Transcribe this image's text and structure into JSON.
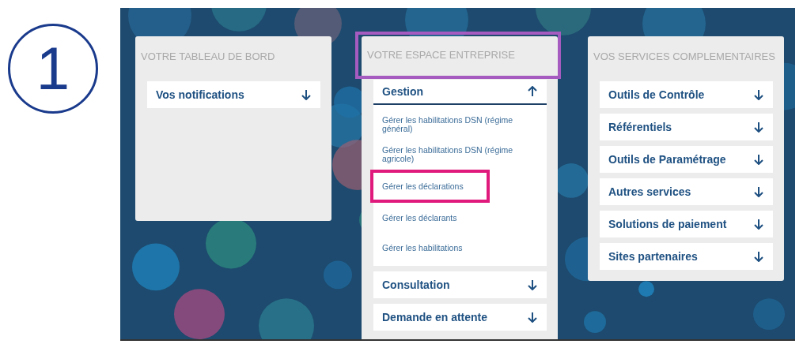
{
  "step": "1",
  "cards": [
    {
      "title": "VOTRE TABLEAU DE BORD",
      "sections": [
        {
          "label": "Vos notifications",
          "expanded": false
        }
      ]
    },
    {
      "title": "VOTRE ESPACE ENTREPRISE",
      "color": "#a55bbf",
      "sections": [
        {
          "label": "Gestion",
          "expanded": true,
          "links": [
            {
              "label": "Gérer les habilitations DSN (régime général)"
            },
            {
              "label": "Gérer les habilitations DSN (régime agricole)"
            },
            {
              "label": "Gérer les déclarations",
              "color": "#e0197d"
            },
            {
              "label": "Gérer les déclarants"
            },
            {
              "label": "Gérer les habilitations"
            }
          ]
        },
        {
          "label": "Consultation",
          "expanded": false
        },
        {
          "label": "Demande en attente",
          "expanded": false
        }
      ]
    },
    {
      "title": "VOS SERVICES COMPLEMENTAIRES",
      "sections": [
        {
          "label": "Outils de Contrôle",
          "expanded": false
        },
        {
          "label": "Référentiels",
          "expanded": false
        },
        {
          "label": "Outils de Paramétrage",
          "expanded": false
        },
        {
          "label": "Autres services",
          "expanded": false
        },
        {
          "label": "Solutions de paiement",
          "expanded": false
        },
        {
          "label": "Sites partenaires",
          "expanded": false
        }
      ]
    }
  ]
}
